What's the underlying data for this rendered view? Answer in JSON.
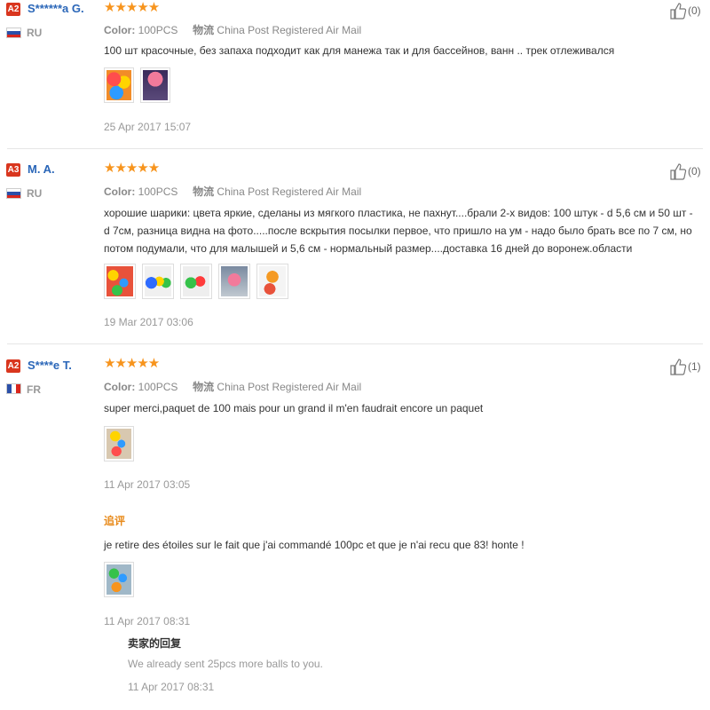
{
  "reviews": [
    {
      "level": "A2",
      "username": "S******a G.",
      "country": "RU",
      "rating": "★★★★★",
      "likes": "(0)",
      "color_label": "Color:",
      "color_value": "100PCS",
      "shipping_label": "物流",
      "shipping_value": "China Post Registered Air Mail",
      "text": "100 шт красочные, без запаха подходит как для манежа так и для бассейнов, ванн .. трек отлеживался",
      "date": "25 Apr 2017 15:07"
    },
    {
      "level": "A3",
      "username": "M. A.",
      "country": "RU",
      "rating": "★★★★★",
      "likes": "(0)",
      "color_label": "Color:",
      "color_value": "100PCS",
      "shipping_label": "物流",
      "shipping_value": "China Post Registered Air Mail",
      "text": "хорошие шарики: цвета яркие, сделаны из мягкого пластика, не пахнут....брали 2-х видов: 100 штук - d 5,6 см и 50 шт - d 7см, разница видна на фото.....после вскрытия посылки первое, что пришло на ум - надо было брать все по 7 см, но потом подумали, что для малышей и 5,6 см - нормальный размер....доставка 16 дней до воронеж.области",
      "date": "19 Mar 2017 03:06"
    },
    {
      "level": "A2",
      "username": "S****e T.",
      "country": "FR",
      "rating": "★★★★★",
      "likes": "(1)",
      "color_label": "Color:",
      "color_value": "100PCS",
      "shipping_label": "物流",
      "shipping_value": "China Post Registered Air Mail",
      "text": "super merci,paquet de 100 mais pour un grand il m'en faudrait encore un paquet",
      "date": "11 Apr 2017 03:05",
      "followup_title": "追评",
      "followup_text": "je retire des étoiles sur le fait que j'ai commandé 100pc et que je n'ai recu que 83! honte !",
      "followup_date": "11 Apr 2017 08:31",
      "seller_title": "卖家的回复",
      "seller_text": "We already sent 25pcs more balls to you.",
      "seller_date": "11 Apr 2017 08:31"
    }
  ],
  "colors": {
    "accent": "#2a66b8",
    "star": "#f7941d",
    "level_badge": "#d9361e",
    "followup": "#e88a1a"
  },
  "icons": {
    "like": "thumbs-up-icon",
    "flag_ru": "russia-flag-icon",
    "flag_fr": "france-flag-icon"
  }
}
